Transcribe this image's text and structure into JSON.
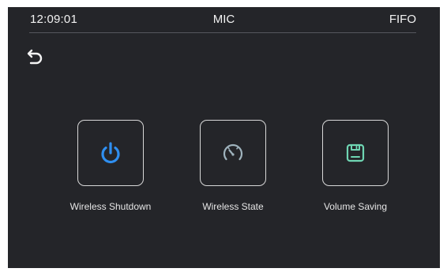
{
  "status_bar": {
    "time": "12:09:01",
    "mode": "MIC",
    "buffer": "FIFO"
  },
  "back": {
    "icon": "back-arrow-icon"
  },
  "tiles": [
    {
      "label": "Wireless Shutdown",
      "icon": "power-icon",
      "icon_color": "#2f8ff0"
    },
    {
      "label": "Wireless State",
      "icon": "gauge-icon",
      "icon_color": "#9fb3bd"
    },
    {
      "label": "Volume Saving",
      "icon": "save-icon",
      "icon_color": "#6fd6b3"
    }
  ],
  "colors": {
    "background": "#242529",
    "text": "#f2f2f2",
    "tile_border": "#d8d8d8"
  }
}
